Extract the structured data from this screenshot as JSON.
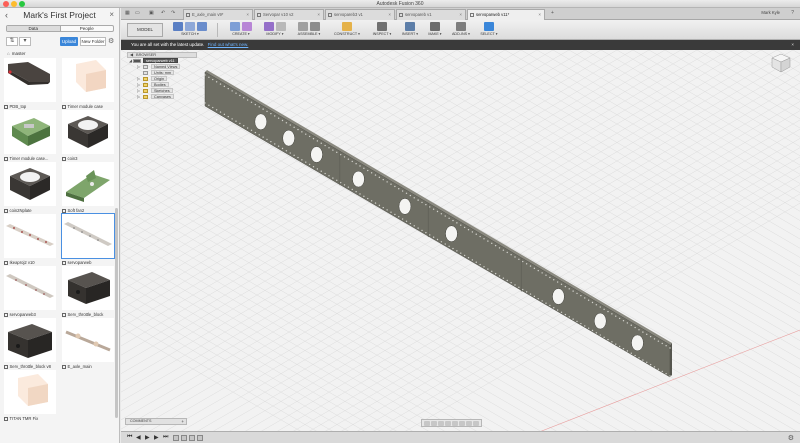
{
  "app": {
    "title": "Autodesk Fusion 360"
  },
  "panel": {
    "project_title": "Mark's First Project",
    "tabs": [
      "Data",
      "People"
    ],
    "upload_label": "Upload",
    "new_folder_label": "New Folder",
    "breadcrumb": "master",
    "items": [
      {
        "label": "PDB_top"
      },
      {
        "label": "Timer module case"
      },
      {
        "label": "Timer module case..."
      },
      {
        "label": "coin3"
      },
      {
        "label": "coin2Nplate"
      },
      {
        "label": "Soft fan2"
      },
      {
        "label": "Ikeaproj2 v10"
      },
      {
        "label": "servoparweb"
      },
      {
        "label": "servoparweb3"
      },
      {
        "label": "Serv_throttle_block"
      },
      {
        "label": "Serv_throttle_block v8"
      },
      {
        "label": "E_axle_main"
      },
      {
        "label": "TITAN TMR Fix"
      }
    ]
  },
  "tabs": [
    {
      "label": "E_axle_main v9*"
    },
    {
      "label": "Servopar v10 v2"
    },
    {
      "label": "servopareb3 v1"
    },
    {
      "label": "servopareb v1"
    },
    {
      "label": "servoparweb v11*"
    }
  ],
  "header": {
    "user": "Mark Kyle"
  },
  "ribbon": {
    "mode": "MODEL",
    "groups": [
      {
        "label": "SKETCH ▾"
      },
      {
        "label": "CREATE ▾"
      },
      {
        "label": "MODIFY ▾"
      },
      {
        "label": "ASSEMBLE ▾"
      },
      {
        "label": "CONSTRUCT ▾"
      },
      {
        "label": "INSPECT ▾"
      },
      {
        "label": "INSERT ▾"
      },
      {
        "label": "MAKE ▾"
      },
      {
        "label": "ADD-INS ▾"
      },
      {
        "label": "SELECT ▾"
      }
    ]
  },
  "notice": {
    "text": "You are all set with the latest update.",
    "link": "Find out what's new."
  },
  "browser": {
    "title": "BROWSER",
    "root": "servoparweb v11",
    "nodes": [
      "Named Views",
      "Units: mm",
      "Origin",
      "Bodies",
      "Sketches",
      "Canvases"
    ]
  },
  "comments": {
    "label": "COMMENTS"
  },
  "colors": {
    "accent": "#3a86d9",
    "part": "#6e6e64",
    "notice_bg": "#3a3a3a"
  }
}
